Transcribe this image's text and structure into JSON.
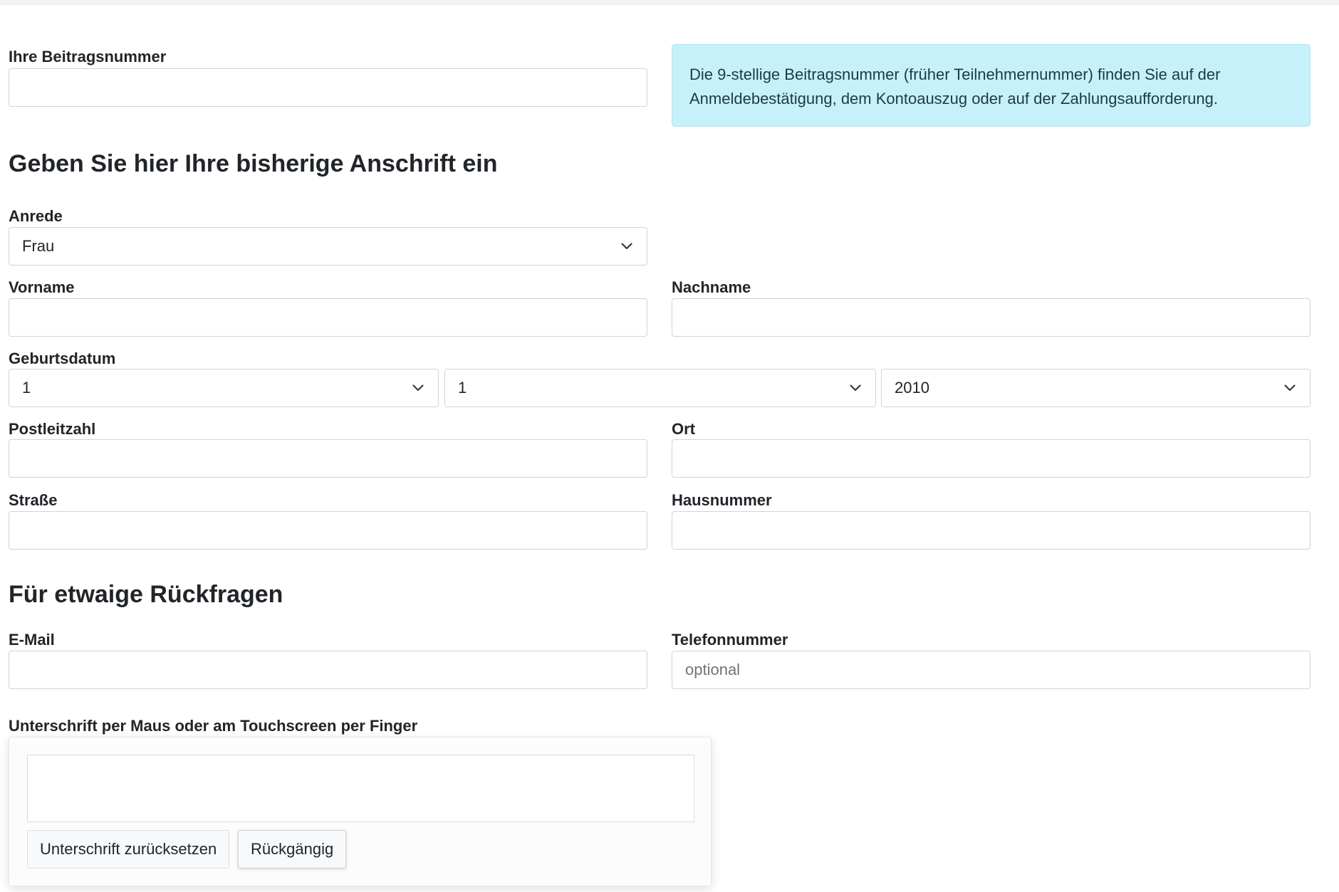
{
  "contribution": {
    "label": "Ihre Beitragsnummer",
    "value": "",
    "info": "Die 9-stellige Beitragsnummer (früher Teilnehmernummer) finden Sie auf der Anmeldebestätigung, dem Kontoauszug oder auf der Zahlungsaufforderung."
  },
  "address": {
    "heading": "Geben Sie hier Ihre bisherige Anschrift ein",
    "salutation_label": "Anrede",
    "salutation_value": "Frau",
    "firstname_label": "Vorname",
    "lastname_label": "Nachname",
    "birthdate_label": "Geburtsdatum",
    "birth_day": "1",
    "birth_month": "1",
    "birth_year": "2010",
    "zip_label": "Postleitzahl",
    "city_label": "Ort",
    "street_label": "Straße",
    "housenumber_label": "Hausnummer"
  },
  "contact": {
    "heading": "Für etwaige Rückfragen",
    "email_label": "E-Mail",
    "phone_label": "Telefonnummer",
    "phone_placeholder": "optional"
  },
  "signature": {
    "label": "Unterschrift per Maus oder am Touchscreen per Finger",
    "reset_button": "Unterschrift zurücksetzen",
    "undo_button": "Rückgängig"
  },
  "icons": {
    "select_arrow": "chevron-down-icon"
  },
  "colors": {
    "info_bg": "#c6f1fb",
    "info_border": "#abe5f3",
    "field_border": "#cfd4d9",
    "text": "#212529"
  }
}
